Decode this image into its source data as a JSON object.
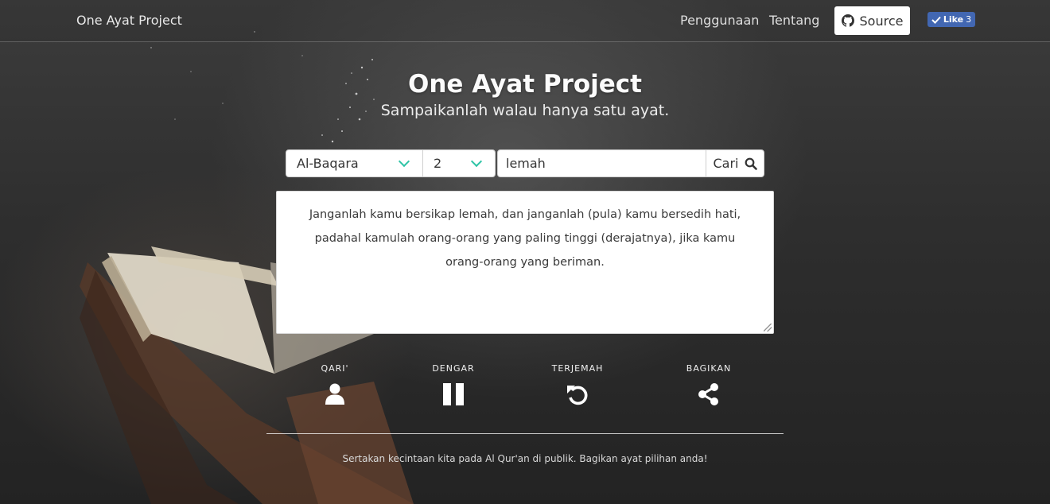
{
  "navbar": {
    "brand": "One Ayat Project",
    "links": [
      "Penggunaan",
      "Tentang"
    ],
    "source_label": "Source",
    "like_label": "Like",
    "like_count": "3"
  },
  "hero": {
    "title": "One Ayat Project",
    "subtitle": "Sampaikanlah walau hanya satu ayat."
  },
  "search": {
    "surah": "Al-Baqara",
    "ayat": "2",
    "query": "lemah",
    "button_label": "Cari"
  },
  "translation": {
    "text": "Janganlah kamu bersikap lemah, dan janganlah (pula) kamu bersedih hati, padahal kamulah orang-orang yang paling tinggi (derajatnya), jika kamu orang-orang yang beriman."
  },
  "actions": [
    {
      "label": "QARI'",
      "icon": "user-icon"
    },
    {
      "label": "DENGAR",
      "icon": "pause-icon"
    },
    {
      "label": "TERJEMAH",
      "icon": "refresh-icon"
    },
    {
      "label": "BAGIKAN",
      "icon": "share-icon"
    }
  ],
  "footer": {
    "text": "Sertakan kecintaan kita pada Al Qur'an di publik. Bagikan ayat pilihan anda!"
  },
  "colors": {
    "accent": "#2ec4a6",
    "facebook": "#4267b2"
  }
}
